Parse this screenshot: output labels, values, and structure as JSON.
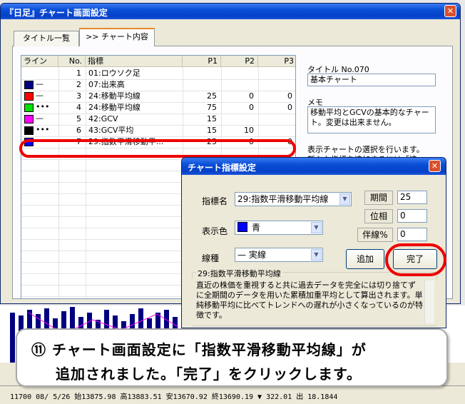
{
  "window": {
    "title": "『日足』チャート画面設定"
  },
  "tabs": [
    "タイトル一覧",
    ">> チャート内容"
  ],
  "grid": {
    "headers": [
      "ライン",
      "No.",
      "指標",
      "P1",
      "P2",
      "P3"
    ],
    "rows": [
      {
        "color": "",
        "line": "",
        "no": "1",
        "name": "01:ロウソク足",
        "p1": "",
        "p2": "",
        "p3": ""
      },
      {
        "color": "#000080",
        "line": "—",
        "no": "2",
        "name": "07:出来高",
        "p1": "",
        "p2": "",
        "p3": ""
      },
      {
        "color": "#ff0000",
        "line": "—",
        "no": "3",
        "name": "24:移動平均線",
        "p1": "25",
        "p2": "0",
        "p3": "0"
      },
      {
        "color": "#00e000",
        "line": "•••",
        "no": "4",
        "name": "24:移動平均線",
        "p1": "75",
        "p2": "0",
        "p3": "0"
      },
      {
        "color": "#ff00ff",
        "line": "—",
        "no": "5",
        "name": "42:GCV",
        "p1": "15",
        "p2": "",
        "p3": ""
      },
      {
        "color": "#000000",
        "line": "•••",
        "no": "6",
        "name": "43:GCV平均",
        "p1": "15",
        "p2": "10",
        "p3": ""
      },
      {
        "color": "#0000ff",
        "line": "—",
        "no": "7",
        "name": "29:指数平滑移動平...",
        "p1": "25",
        "p2": "0",
        "p3": "0"
      }
    ]
  },
  "side": {
    "title_label": "タイトル No.070",
    "title_value": "基本チャート",
    "memo_label": "メモ",
    "memo_value": "移動平均とGCVの基本的なチャート。変更は出来ません。",
    "help_line1": "表示チャートの選択を行います。",
    "help_line2": "新たな指標を追加するには「追"
  },
  "dialog": {
    "title": "チャート指標設定",
    "indicator_label": "指標名",
    "indicator_value": "29:指数平滑移動平均線",
    "color_label": "表示色",
    "color_value": "青",
    "color_hex": "#0000ff",
    "line_label": "線種",
    "line_value": "— 実線",
    "period_label": "期間",
    "period_value": "25",
    "pos_label": "位相",
    "pos_value": "0",
    "dev_label": "伴線%",
    "dev_value": "0",
    "add_button": "追加",
    "done_button": "完了",
    "desc_title": "29:指数平滑移動平均線",
    "desc_text": "直近の株価を重視すると共に過去データを完全には切り捨てずに全期間のデータを用いた累積加重平均として算出されます。単純移動平均に比べてトレンドへの遅れが小さくなっているのが特徴です。"
  },
  "callout": {
    "line1": "⑪ チャート画面設定に「指数平滑移動平均線」が",
    "line2": "追加されました。「完了」をクリックします。"
  },
  "status": {
    "text": "11700 08/ 5/26 始13875.98 高13883.51 安13670.92 終13690.19 ▼ 322.01 出  18.1844"
  }
}
